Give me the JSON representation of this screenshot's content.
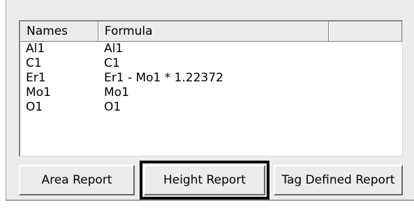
{
  "table": {
    "columns": [
      "Names",
      "Formula",
      ""
    ],
    "rows": [
      {
        "name": "Al1",
        "formula": "Al1"
      },
      {
        "name": "C1",
        "formula": "C1"
      },
      {
        "name": "Er1",
        "formula": "Er1 - Mo1 * 1.22372"
      },
      {
        "name": "Mo1",
        "formula": "Mo1"
      },
      {
        "name": "O1",
        "formula": "O1"
      }
    ]
  },
  "buttons": {
    "area_report": "Area Report",
    "height_report": "Height Report",
    "tag_defined_report": "Tag Defined Report"
  },
  "colors": {
    "panel_background": "#ececec",
    "list_background": "#ffffff",
    "focus_outline": "#000000"
  }
}
